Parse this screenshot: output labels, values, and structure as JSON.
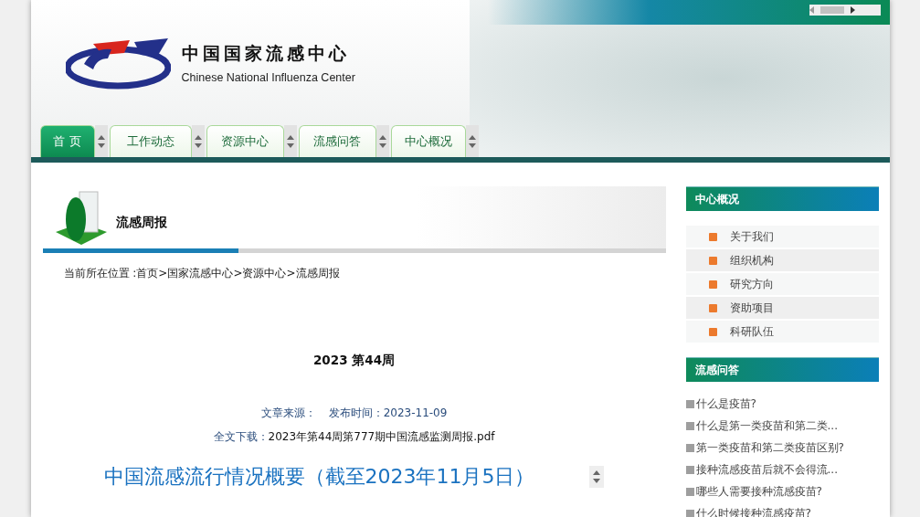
{
  "header": {
    "title": "中国国家流感中心",
    "subtitle": "Chinese National Influenza Center"
  },
  "nav": [
    {
      "label": "首 页",
      "selected": true
    },
    {
      "label": "工作动态",
      "selected": false
    },
    {
      "label": "资源中心",
      "selected": false
    },
    {
      "label": "流感问答",
      "selected": false
    },
    {
      "label": "中心概况",
      "selected": false
    }
  ],
  "section": {
    "title": "流感周报",
    "breadcrumb": "当前所在位置 :首页>国家流感中心>资源中心>流感周报"
  },
  "article": {
    "heading": "2023 第44周",
    "source_label": "文章来源：",
    "date_label": "发布时间：",
    "date": "2023-11-09",
    "download_label": "全文下载：",
    "download_file": "2023年第44周第777期中国流感监测周报.pdf",
    "subtitle": "中国流感流行情况概要（截至2023年11月5日）"
  },
  "sidebar": [
    {
      "title": "中心概况",
      "kind": "menu",
      "items": [
        "关于我们",
        "组织机构",
        "研究方向",
        "资助项目",
        "科研队伍"
      ]
    },
    {
      "title": "流感问答",
      "kind": "links",
      "items": [
        "什么是疫苗?",
        "什么是第一类疫苗和第二类...",
        "第一类疫苗和第二类疫苗区别?",
        "接种流感疫苗后就不会得流...",
        "哪些人需要接种流感疫苗?",
        "什么时候接种流感疫苗?"
      ]
    }
  ]
}
